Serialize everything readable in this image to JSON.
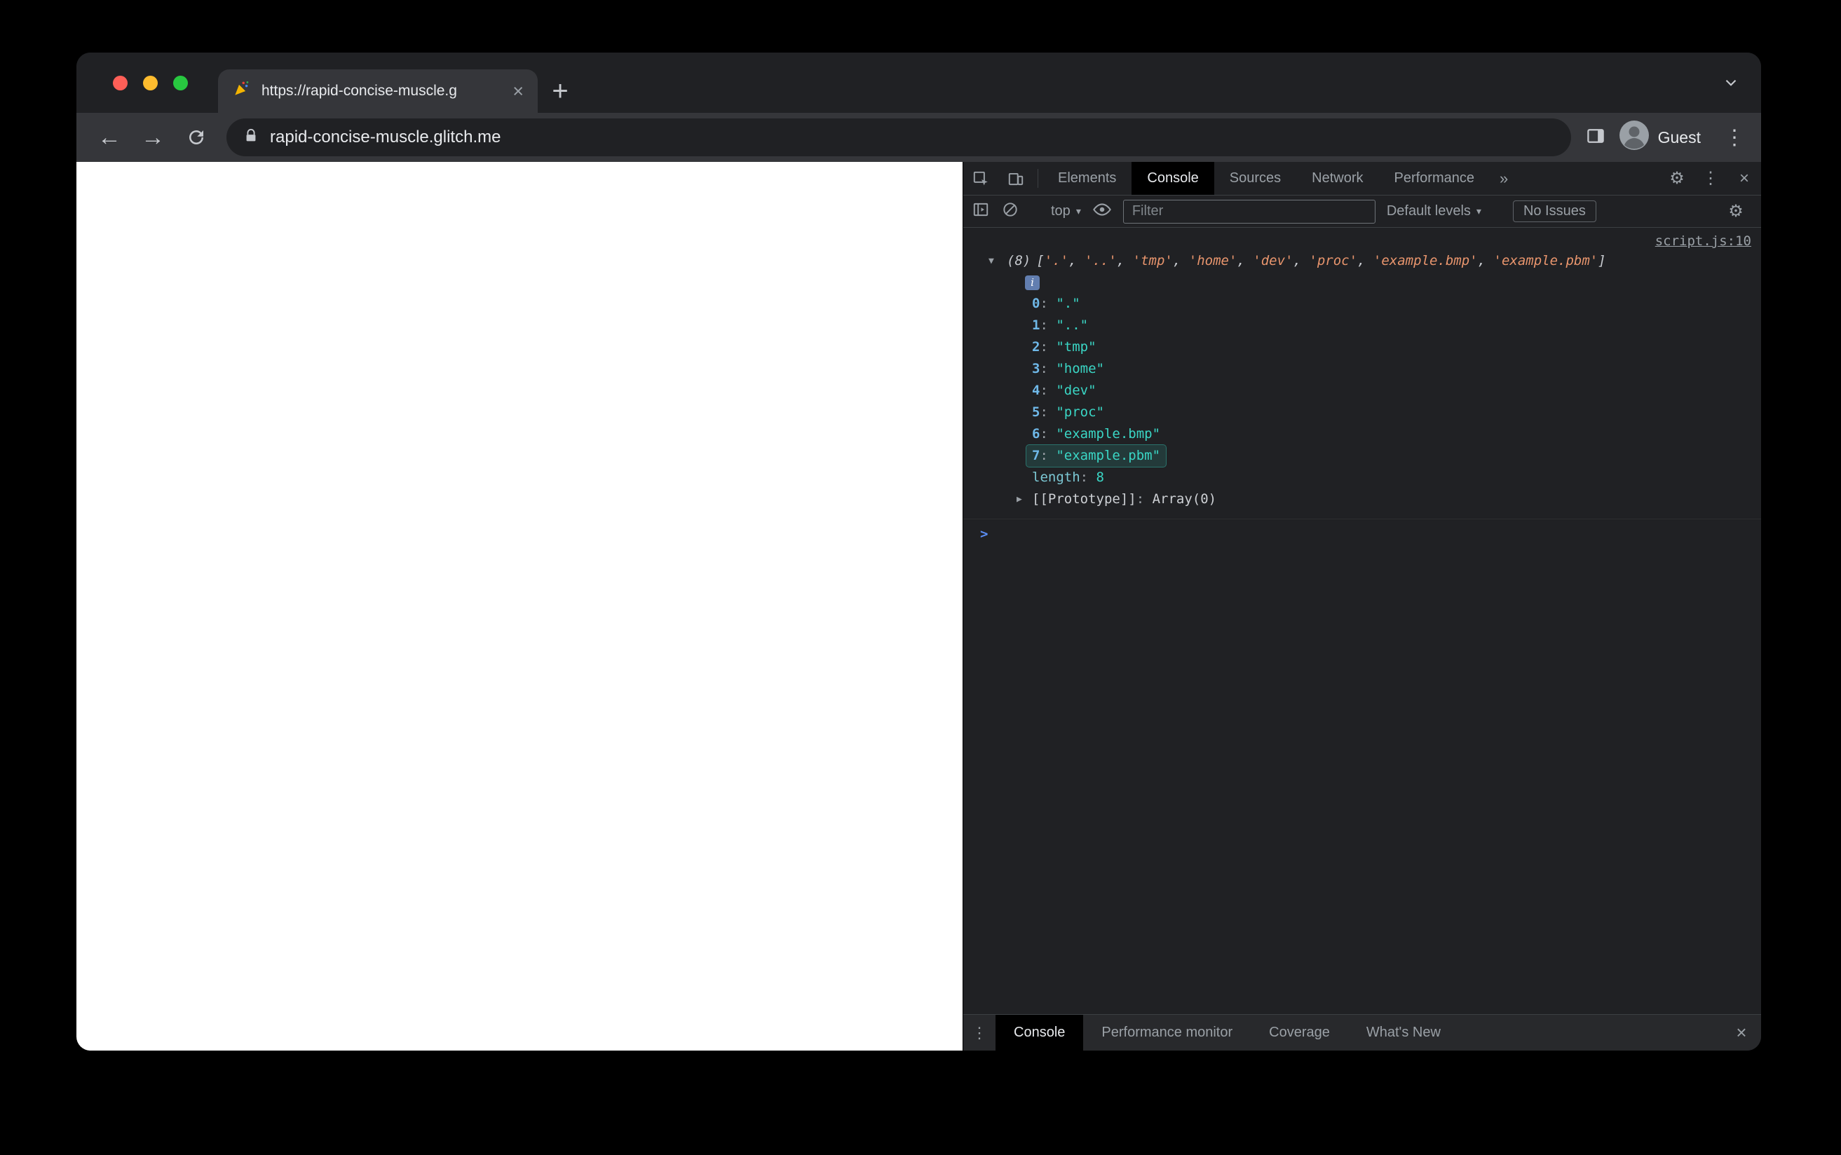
{
  "icons": {
    "close": "×",
    "plus": "+",
    "back": "←",
    "forward": "→",
    "kebab": "⋮",
    "gear": "⚙",
    "more_tabs": "»",
    "dropdown_arrow": "▾",
    "expanded_triangle": "▼",
    "collapsed_triangle": "▶",
    "info": "i",
    "prompt": ">",
    "tab_favicon": "party-popper-icon"
  },
  "punct": {
    "colon": ": ",
    "bracket_open": "[",
    "bracket_close": "]"
  },
  "browser": {
    "tab_title": "https://rapid-concise-muscle.g",
    "url": "rapid-concise-muscle.glitch.me",
    "profile_label": "Guest"
  },
  "devtools": {
    "tabs": [
      "Elements",
      "Console",
      "Sources",
      "Network",
      "Performance"
    ],
    "active_tab": "Console",
    "toolbar": {
      "context": "top",
      "filter_placeholder": "Filter",
      "levels": "Default levels",
      "issues": "No Issues"
    },
    "console": {
      "source_link": "script.js:10",
      "preview_count": "(8)",
      "preview_items": [
        "'.'",
        "'..'",
        "'tmp'",
        "'home'",
        "'dev'",
        "'proc'",
        "'example.bmp'",
        "'example.pbm'"
      ],
      "entries": [
        {
          "index": "0",
          "value": "\".\""
        },
        {
          "index": "1",
          "value": "\"..\""
        },
        {
          "index": "2",
          "value": "\"tmp\""
        },
        {
          "index": "3",
          "value": "\"home\""
        },
        {
          "index": "4",
          "value": "\"dev\""
        },
        {
          "index": "5",
          "value": "\"proc\""
        },
        {
          "index": "6",
          "value": "\"example.bmp\""
        },
        {
          "index": "7",
          "value": "\"example.pbm\"",
          "highlighted": true
        }
      ],
      "length_label": "length",
      "length_value": "8",
      "prototype_label": "[[Prototype]]",
      "prototype_value": "Array(0)"
    },
    "drawer": {
      "tabs": [
        "Console",
        "Performance monitor",
        "Coverage",
        "What's New"
      ],
      "active_tab": "Console"
    }
  },
  "colors": {
    "string_preview": "#e8956d",
    "string_value": "#3ad6c5",
    "array_index": "#6fb8e8",
    "prompt_blue": "#5b8ef4",
    "traffic_red": "#ff5f57",
    "traffic_yellow": "#febc2e",
    "traffic_green": "#28c840"
  }
}
